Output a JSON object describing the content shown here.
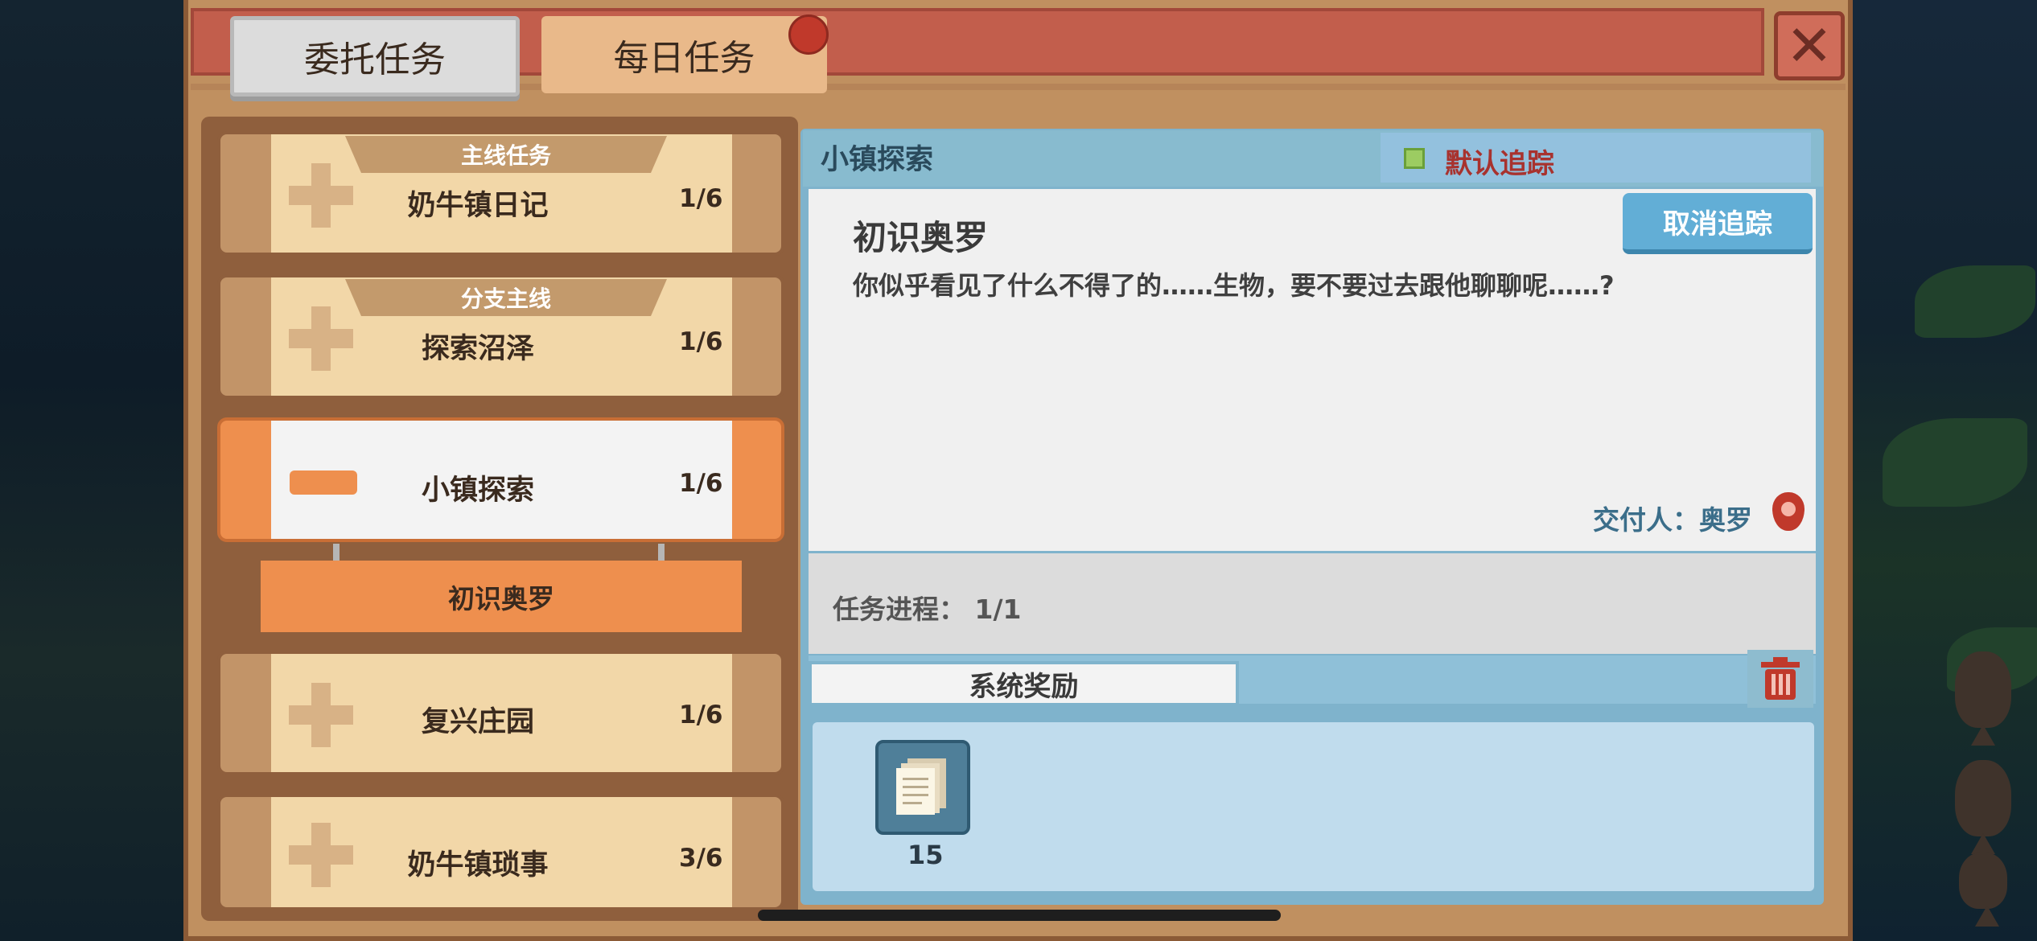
{
  "tabs": [
    {
      "label": "委托任务",
      "active": true
    },
    {
      "label": "每日任务",
      "active": false,
      "has_notification": true
    }
  ],
  "close_icon": "close-x-icon",
  "quest_list": [
    {
      "category": "主线任务",
      "name": "奶牛镇日记",
      "progress": "1/6",
      "expanded": false
    },
    {
      "category": "分支主线",
      "name": "探索沼泽",
      "progress": "1/6",
      "expanded": false
    },
    {
      "category": "",
      "name": "小镇探索",
      "progress": "1/6",
      "expanded": true,
      "sub_quests": [
        "初识奥罗"
      ]
    },
    {
      "category": "",
      "name": "复兴庄园",
      "progress": "1/6",
      "expanded": false
    },
    {
      "category": "",
      "name": "奶牛镇琐事",
      "progress": "3/6",
      "expanded": false
    }
  ],
  "detail": {
    "header_title": "小镇探索",
    "track_label": "默认追踪",
    "untrack_button": "取消追踪",
    "quest_title": "初识奥罗",
    "description": "你似乎看见了什么不得了的……生物，要不要过去跟他聊聊呢……?",
    "giver": "交付人：奥罗",
    "progress": "任务进程： 1/1",
    "reward_tab": "系统奖励",
    "rewards": [
      {
        "icon": "paper-stack-icon",
        "quantity": "15"
      }
    ]
  },
  "colors": {
    "accent_orange": "#ee8f4e",
    "header_red": "#c25e4c",
    "panel_blue": "#7fb3cc",
    "track_red": "#a8322e"
  }
}
